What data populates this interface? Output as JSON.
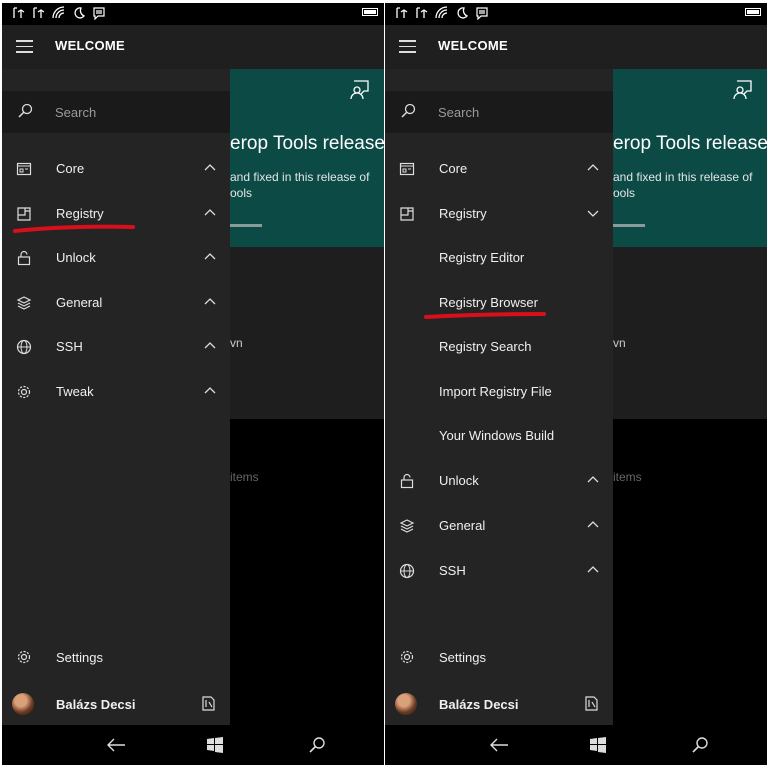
{
  "header": {
    "title": "WELCOME"
  },
  "search": {
    "placeholder": "Search"
  },
  "background": {
    "card_title": "erop Tools release?",
    "card_text_line1": "and fixed in this release of",
    "card_text_line2": "ools",
    "fragment_wn": "vn",
    "fragment_items": "items"
  },
  "left_panel": {
    "items": [
      {
        "label": "Core",
        "icon": "core-icon",
        "chevron": "up"
      },
      {
        "label": "Registry",
        "icon": "registry-icon",
        "chevron": "up"
      },
      {
        "label": "Unlock",
        "icon": "lock-icon",
        "chevron": "up"
      },
      {
        "label": "General",
        "icon": "layers-icon",
        "chevron": "up"
      },
      {
        "label": "SSH",
        "icon": "globe-icon",
        "chevron": "up"
      },
      {
        "label": "Tweak",
        "icon": "gear-icon",
        "chevron": "up"
      }
    ],
    "annotation_color": "#d8101c"
  },
  "right_panel": {
    "items": [
      {
        "label": "Core",
        "icon": "core-icon",
        "chevron": "up"
      },
      {
        "label": "Registry",
        "icon": "registry-icon",
        "chevron": "down"
      }
    ],
    "subitems": [
      "Registry Editor",
      "Registry Browser",
      "Registry Search",
      "Import Registry File",
      "Your Windows Build"
    ],
    "items_after": [
      {
        "label": "Unlock",
        "icon": "lock-icon",
        "chevron": "up"
      },
      {
        "label": "General",
        "icon": "layers-icon",
        "chevron": "up"
      },
      {
        "label": "SSH",
        "icon": "globe-icon",
        "chevron": "up"
      }
    ]
  },
  "settings": {
    "label": "Settings"
  },
  "user": {
    "name": "Balázs Decsi"
  },
  "colors": {
    "pane": "#242424",
    "card": "#0b4a45",
    "accent_annotation": "#d8101c"
  }
}
